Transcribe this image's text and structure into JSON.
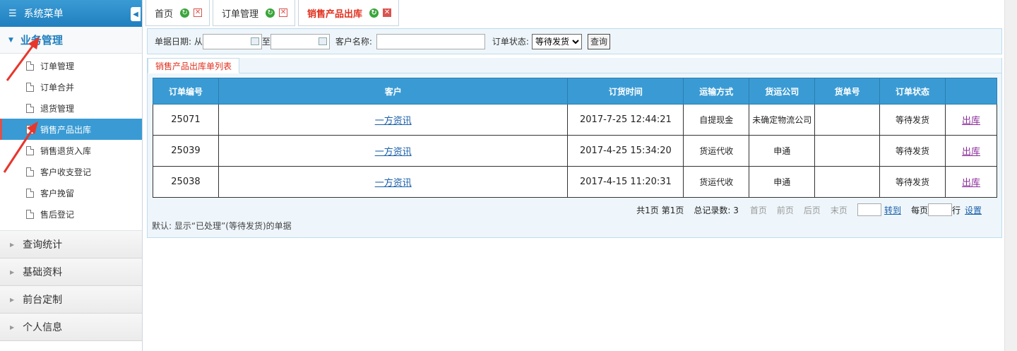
{
  "sidebar": {
    "header": "系统菜单",
    "open_group": "业务管理",
    "items": [
      {
        "label": "订单管理"
      },
      {
        "label": "订单合并"
      },
      {
        "label": "退货管理"
      },
      {
        "label": "销售产品出库"
      },
      {
        "label": "销售退货入库"
      },
      {
        "label": "客户收支登记"
      },
      {
        "label": "客户挽留"
      },
      {
        "label": "售后登记"
      }
    ],
    "groups": [
      "查询统计",
      "基础资料",
      "前台定制",
      "个人信息"
    ]
  },
  "tabs": [
    {
      "label": "首页"
    },
    {
      "label": "订单管理"
    },
    {
      "label": "销售产品出库"
    }
  ],
  "filter": {
    "date_label": "单据日期: 从",
    "to_label": "至",
    "customer_label": "客户名称:",
    "status_label": "订单状态:",
    "status_value": "等待发货",
    "search_label": "查询"
  },
  "panel_tab": "销售产品出库单列表",
  "table": {
    "headers": [
      "订单编号",
      "客户",
      "订货时间",
      "运输方式",
      "货运公司",
      "货单号",
      "订单状态",
      ""
    ],
    "rows": [
      {
        "id": "25071",
        "customer": "一方资讯",
        "time": "2017-7-25 12:44:21",
        "transport": "自提现金",
        "company": "未确定物流公司",
        "waybill": "",
        "status": "等待发货",
        "action": "出库"
      },
      {
        "id": "25039",
        "customer": "一方资讯",
        "time": "2017-4-25 15:34:20",
        "transport": "货运代收",
        "company": "申通",
        "waybill": "",
        "status": "等待发货",
        "action": "出库"
      },
      {
        "id": "25038",
        "customer": "一方资讯",
        "time": "2017-4-15 11:20:31",
        "transport": "货运代收",
        "company": "申通",
        "waybill": "",
        "status": "等待发货",
        "action": "出库"
      }
    ]
  },
  "pager": {
    "pages": "共1页",
    "current": "第1页",
    "total": "总记录数: 3",
    "first": "首页",
    "prev": "前页",
    "next": "后页",
    "last": "末页",
    "goto": "转到",
    "per_page": "每页",
    "rows_unit": "行",
    "settings": "设置"
  },
  "note": "默认: 显示“已处理”(等待发货)的单据",
  "colors": {
    "accent": "#3a9bd4",
    "active_tab": "#e0301e",
    "arrow": "#e8362c"
  }
}
